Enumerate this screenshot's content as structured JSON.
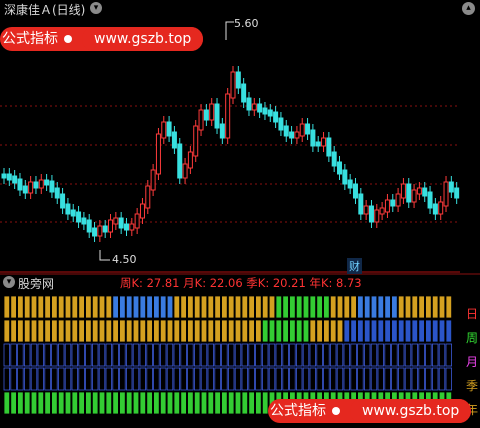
{
  "window": {
    "title": "深康佳Ａ(日线)",
    "dropdown_icon": "chevron-down-icon",
    "control_icon": "chevron-up-icon"
  },
  "watermark": {
    "label": "公式指标",
    "url": "www.gszb.top",
    "color": "#e5281f"
  },
  "price_chart": {
    "high_label": "5.60",
    "low_label": "4.50",
    "marker": "财",
    "up_color": "#ff3b3b",
    "down_color": "#38e0e0",
    "gridline_color": "#8a1010"
  },
  "indicator": {
    "name": "股旁网",
    "values_text": "周K: 27.81  月K: 22.06  季K: 20.21  年K: 8.73",
    "rows": [
      {
        "label": "日",
        "color": "#ff3333"
      },
      {
        "label": "周",
        "color": "#33dd33"
      },
      {
        "label": "月",
        "color": "#ee44ee"
      },
      {
        "label": "季",
        "color": "#d4a020"
      },
      {
        "label": "年",
        "color": "#d4a020"
      }
    ]
  }
}
